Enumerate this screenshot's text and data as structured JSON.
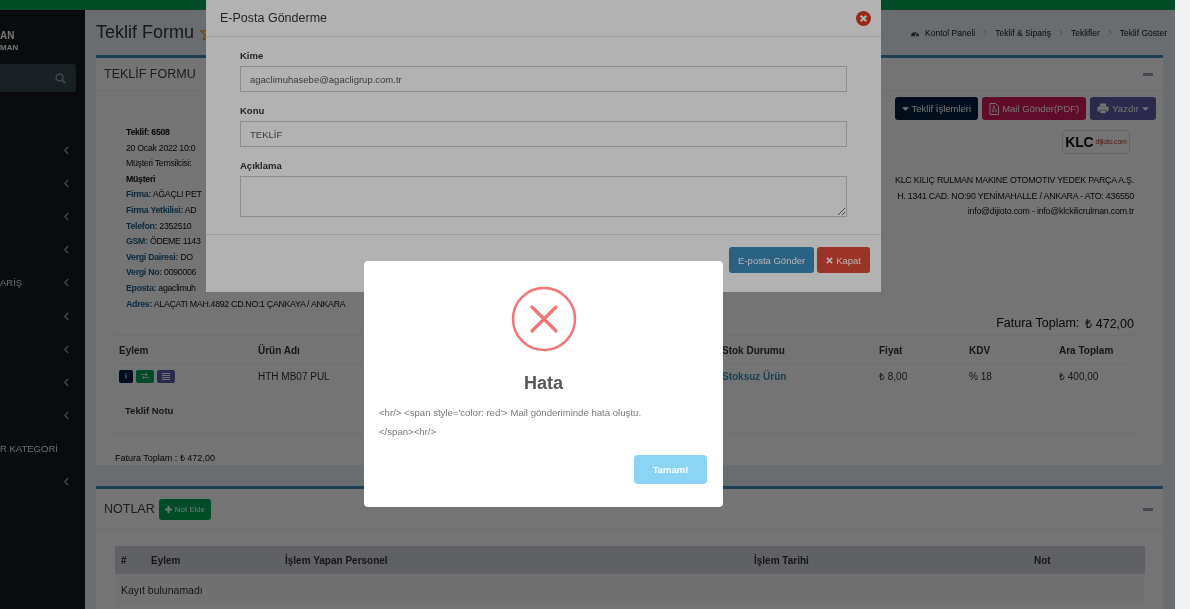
{
  "sidebar": {
    "user_name": "AN",
    "user_role": "MAN",
    "items": [
      {
        "expandable": true
      },
      {
        "expandable": true
      },
      {
        "expandable": true
      },
      {
        "expandable": true
      },
      {
        "label": "ARİŞ",
        "expandable": true
      },
      {
        "expandable": true
      },
      {
        "expandable": true
      },
      {
        "expandable": true
      },
      {
        "expandable": true
      },
      {
        "label": "R KATEGORİ",
        "expandable": false
      },
      {
        "expandable": true
      }
    ]
  },
  "page": {
    "title": "Teklif Formu",
    "breadcrumb": [
      "Kontol Paneli",
      "Teklif & Sipariş",
      "Teklifler",
      "Teklif Göster"
    ]
  },
  "quote_box": {
    "title": "TEKLİF FORMU",
    "actions": [
      {
        "label": "Teklif İşlemleri",
        "kind": "operations"
      },
      {
        "label": "Mail Gönder(PDF)",
        "kind": "mail"
      },
      {
        "label": "Yazdır",
        "kind": "print"
      }
    ],
    "customer_info": [
      {
        "kind": "heading",
        "text": "Teklif: 6508"
      },
      {
        "kind": "plain",
        "text": "20 Ocak 2022 10:0"
      },
      {
        "kind": "plain",
        "text": "Müşteri Temsilcisi:"
      },
      {
        "kind": "heading",
        "text": "Müşteri"
      },
      {
        "kind": "field",
        "label": "Firma:",
        "value": "AĞAÇLI PET"
      },
      {
        "kind": "field",
        "label": "Firma Yetkilisi:",
        "value": "AD"
      },
      {
        "kind": "field",
        "label": "Telefon:",
        "value": "2352510"
      },
      {
        "kind": "field",
        "label": "GSM:",
        "value": "ÖDEME 1143"
      },
      {
        "kind": "field",
        "label": "Vergi Dairesi:",
        "value": "DO"
      },
      {
        "kind": "field",
        "label": "Vergi No:",
        "value": "0090006"
      },
      {
        "kind": "field",
        "label": "Eposta:",
        "value": "agaclimuh"
      },
      {
        "kind": "field",
        "label": "Adres:",
        "value": "ALAÇATI MAH.4892 CD.NO:1 ÇANKAYA / ANKARA"
      }
    ],
    "company": {
      "logo_text": "KLC",
      "logo_tagline": "dijioto.com",
      "lines": [
        "KLC KILIÇ RULMAN MAKINE OTOMOTIV YEDEK PARÇA A.Ş.",
        "H. 1341 CAD. NO:90 YENİMAHALLE / ANKARA - ATO: 436550",
        "info@dijioto.com - info@klckilicrulman.com.tr"
      ]
    },
    "total_label": "Fatura Toplam:",
    "total_value": "₺ 472,00",
    "table": {
      "columns": [
        "Eylem",
        "Ürün Adı",
        "Stok Durumu",
        "Fiyat",
        "KDV",
        "Ara Toplam"
      ],
      "rows": [
        {
          "cells": [
            {
              "actions": [
                {
                  "kind": "info"
                },
                {
                  "kind": "transfer"
                },
                {
                  "kind": "list"
                }
              ]
            },
            "HTH MB07 PUL",
            "Stoksuz Ürün",
            "₺ 8,00",
            "% 18",
            "₺ 400,00"
          ]
        }
      ]
    },
    "note_label": "Teklif Notu",
    "footer_total": "Fatura Toplam : ₺ 472,00"
  },
  "notes_box": {
    "title": "NOTLAR",
    "add_button": "Not Ekle",
    "columns": [
      "#",
      "Eylem",
      "İşlem Yapan Personel",
      "İşlem Tarihi",
      "Not"
    ],
    "empty_text": "Kayıt bulunamadı"
  },
  "email_modal": {
    "title": "E-Posta Gönderme",
    "fields": [
      {
        "kind": "input",
        "label": "Kime",
        "value": "agaclimuhasebe@agacligrup.com.tr"
      },
      {
        "kind": "input",
        "label": "Konu",
        "value": "TEKLİF"
      },
      {
        "kind": "textarea",
        "label": "Açıklama"
      }
    ],
    "buttons": [
      {
        "kind": "send",
        "label": "E-posta Gönder"
      },
      {
        "kind": "close",
        "label": "Kapat"
      }
    ]
  },
  "error_dialog": {
    "kind": "error",
    "title": "Hata",
    "message": "<hr/> <span style='color: red'> Mail gönderiminde hata oluştu. </span><hr/>",
    "button": "Tamam!"
  }
}
